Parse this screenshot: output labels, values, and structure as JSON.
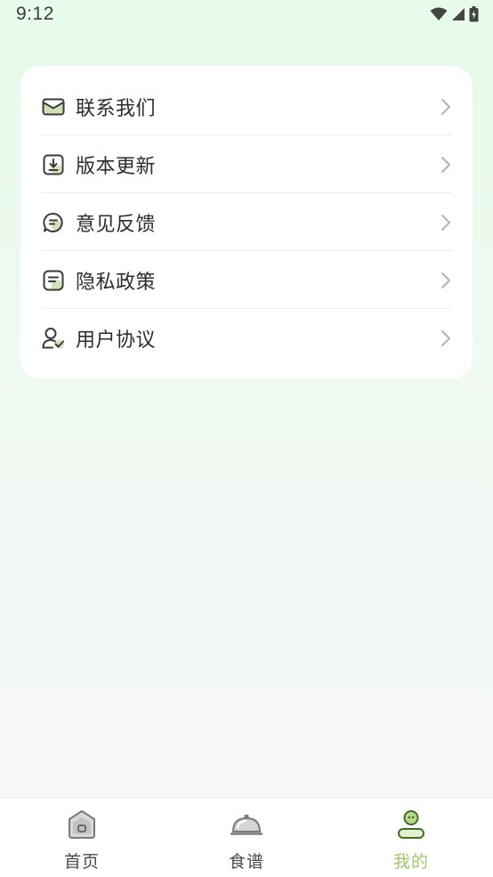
{
  "status_bar": {
    "time": "9:12",
    "icons": [
      "wifi-icon",
      "cell-signal-icon",
      "battery-icon"
    ]
  },
  "menu": {
    "items": [
      {
        "label": "联系我们",
        "icon": "mail-icon"
      },
      {
        "label": "版本更新",
        "icon": "download-icon"
      },
      {
        "label": "意见反馈",
        "icon": "feedback-chat-icon"
      },
      {
        "label": "隐私政策",
        "icon": "document-icon"
      },
      {
        "label": "用户协议",
        "icon": "user-check-icon"
      }
    ]
  },
  "tab_bar": {
    "tabs": [
      {
        "label": "首页",
        "icon": "home-icon",
        "active": false
      },
      {
        "label": "食谱",
        "icon": "cloche-icon",
        "active": false
      },
      {
        "label": "我的",
        "icon": "profile-icon",
        "active": true
      }
    ]
  },
  "colors": {
    "accent": "#9fc96a",
    "icon_dark": "#3a3a3a",
    "icon_fill": "#cfe3b6"
  }
}
